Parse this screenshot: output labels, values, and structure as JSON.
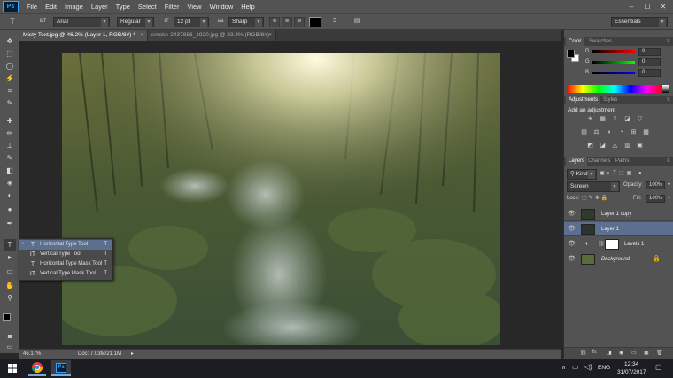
{
  "app": {
    "logo": "Ps"
  },
  "menu": [
    "File",
    "Edit",
    "Image",
    "Layer",
    "Type",
    "Select",
    "Filter",
    "View",
    "Window",
    "Help"
  ],
  "window_controls": {
    "minimize": "–",
    "maximize": "☐",
    "close": "✕"
  },
  "options": {
    "tool_icon": "T",
    "orient_icon": "⇅T",
    "font_family": "Arial",
    "font_style": "Regular",
    "size_icon": "tT",
    "font_size": "12 pt",
    "aa_icon": "aa",
    "antialias": "Sharp",
    "color": "#000000",
    "workspace": "Essentials"
  },
  "tabs": [
    {
      "label": "Misty Text.jpg @ 46.2% (Layer 1, RGB/8#) *",
      "close": "×",
      "active": true
    },
    {
      "label": "smoke-2437886_1920.jpg @ 33.3% (RGB/8#)",
      "close": "×",
      "active": false
    }
  ],
  "status": {
    "zoom": "46.17%",
    "doc": "Doc: 7.03M/21.1M"
  },
  "flyout": [
    {
      "label": "Horizontal Type Tool",
      "icon": "T",
      "shortcut": "T",
      "selected": true,
      "bullet": "•"
    },
    {
      "label": "Vertical Type Tool",
      "icon": "IT",
      "shortcut": "T",
      "selected": false,
      "bullet": ""
    },
    {
      "label": "Horizontal Type Mask Tool",
      "icon": "T",
      "shortcut": "T",
      "selected": false,
      "bullet": ""
    },
    {
      "label": "Vertical Type Mask Tool",
      "icon": "IT",
      "shortcut": "T",
      "selected": false,
      "bullet": ""
    }
  ],
  "tools": [
    "▸✥",
    "⬚",
    "◯",
    "⚡",
    "⌗",
    "✎",
    "✚",
    "🖌",
    "⊥",
    "✎",
    "◧",
    "◈",
    "◐",
    "✒",
    "T",
    "▸",
    "▭",
    "✋",
    "🔍"
  ],
  "color_panel": {
    "tabs": [
      "Color",
      "Swatches"
    ],
    "channels": [
      {
        "label": "R",
        "value": "0",
        "color": "#e03030"
      },
      {
        "label": "G",
        "value": "0",
        "color": "#2ca02c"
      },
      {
        "label": "B",
        "value": "0",
        "color": "#2060d0"
      }
    ]
  },
  "adjustments_panel": {
    "tabs": [
      "Adjustments",
      "Styles"
    ],
    "title": "Add an adjustment",
    "row1": [
      "☀",
      "▦",
      "⎍",
      "◪",
      "▽"
    ],
    "row2": [
      "▤",
      "⚖",
      "◑",
      "◔",
      "⊞",
      "▦"
    ],
    "row3": [
      "◩",
      "◪",
      "◬",
      "▥",
      "▣"
    ]
  },
  "layers_panel": {
    "tabs": [
      "Layers",
      "Channels",
      "Paths"
    ],
    "kind": "Kind",
    "blend_mode": "Screen",
    "opacity_label": "Opacity:",
    "opacity": "100%",
    "lock_label": "Lock:",
    "fill_label": "Fill:",
    "fill": "100%",
    "layers": [
      {
        "name": "Layer 1 copy",
        "selected": false,
        "italic": false
      },
      {
        "name": "Layer 1",
        "selected": true,
        "italic": false
      },
      {
        "name": "Levels 1",
        "selected": false,
        "italic": false
      },
      {
        "name": "Background",
        "selected": false,
        "italic": true
      }
    ],
    "footer_icons": [
      "⛓",
      "fx",
      "◨",
      "◉",
      "▭",
      "🗑"
    ]
  },
  "taskbar": {
    "lang": "ENG",
    "time": "12:34",
    "date": "31/07/2017",
    "ps_label": "Ps"
  }
}
